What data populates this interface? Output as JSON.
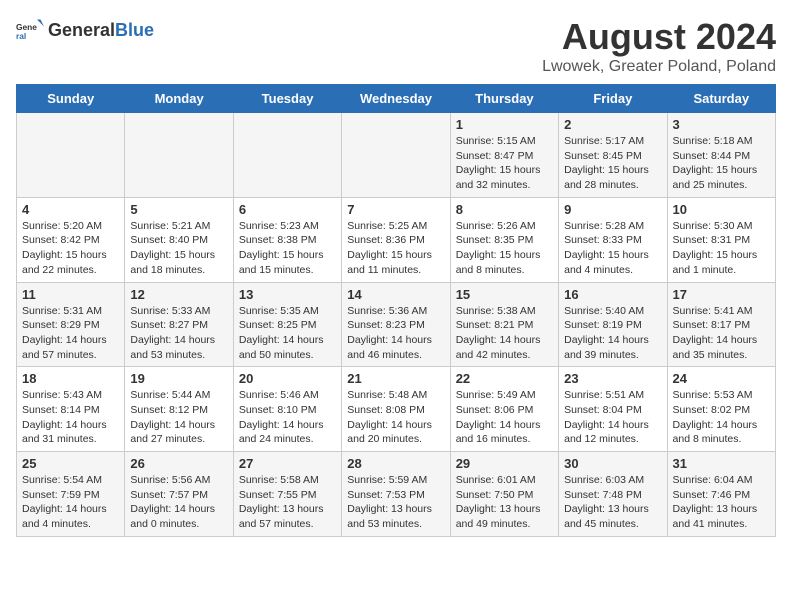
{
  "header": {
    "logo_general": "General",
    "logo_blue": "Blue",
    "title": "August 2024",
    "subtitle": "Lwowek, Greater Poland, Poland"
  },
  "calendar": {
    "days_of_week": [
      "Sunday",
      "Monday",
      "Tuesday",
      "Wednesday",
      "Thursday",
      "Friday",
      "Saturday"
    ],
    "weeks": [
      [
        {
          "day": "",
          "info": ""
        },
        {
          "day": "",
          "info": ""
        },
        {
          "day": "",
          "info": ""
        },
        {
          "day": "",
          "info": ""
        },
        {
          "day": "1",
          "info": "Sunrise: 5:15 AM\nSunset: 8:47 PM\nDaylight: 15 hours\nand 32 minutes."
        },
        {
          "day": "2",
          "info": "Sunrise: 5:17 AM\nSunset: 8:45 PM\nDaylight: 15 hours\nand 28 minutes."
        },
        {
          "day": "3",
          "info": "Sunrise: 5:18 AM\nSunset: 8:44 PM\nDaylight: 15 hours\nand 25 minutes."
        }
      ],
      [
        {
          "day": "4",
          "info": "Sunrise: 5:20 AM\nSunset: 8:42 PM\nDaylight: 15 hours\nand 22 minutes."
        },
        {
          "day": "5",
          "info": "Sunrise: 5:21 AM\nSunset: 8:40 PM\nDaylight: 15 hours\nand 18 minutes."
        },
        {
          "day": "6",
          "info": "Sunrise: 5:23 AM\nSunset: 8:38 PM\nDaylight: 15 hours\nand 15 minutes."
        },
        {
          "day": "7",
          "info": "Sunrise: 5:25 AM\nSunset: 8:36 PM\nDaylight: 15 hours\nand 11 minutes."
        },
        {
          "day": "8",
          "info": "Sunrise: 5:26 AM\nSunset: 8:35 PM\nDaylight: 15 hours\nand 8 minutes."
        },
        {
          "day": "9",
          "info": "Sunrise: 5:28 AM\nSunset: 8:33 PM\nDaylight: 15 hours\nand 4 minutes."
        },
        {
          "day": "10",
          "info": "Sunrise: 5:30 AM\nSunset: 8:31 PM\nDaylight: 15 hours\nand 1 minute."
        }
      ],
      [
        {
          "day": "11",
          "info": "Sunrise: 5:31 AM\nSunset: 8:29 PM\nDaylight: 14 hours\nand 57 minutes."
        },
        {
          "day": "12",
          "info": "Sunrise: 5:33 AM\nSunset: 8:27 PM\nDaylight: 14 hours\nand 53 minutes."
        },
        {
          "day": "13",
          "info": "Sunrise: 5:35 AM\nSunset: 8:25 PM\nDaylight: 14 hours\nand 50 minutes."
        },
        {
          "day": "14",
          "info": "Sunrise: 5:36 AM\nSunset: 8:23 PM\nDaylight: 14 hours\nand 46 minutes."
        },
        {
          "day": "15",
          "info": "Sunrise: 5:38 AM\nSunset: 8:21 PM\nDaylight: 14 hours\nand 42 minutes."
        },
        {
          "day": "16",
          "info": "Sunrise: 5:40 AM\nSunset: 8:19 PM\nDaylight: 14 hours\nand 39 minutes."
        },
        {
          "day": "17",
          "info": "Sunrise: 5:41 AM\nSunset: 8:17 PM\nDaylight: 14 hours\nand 35 minutes."
        }
      ],
      [
        {
          "day": "18",
          "info": "Sunrise: 5:43 AM\nSunset: 8:14 PM\nDaylight: 14 hours\nand 31 minutes."
        },
        {
          "day": "19",
          "info": "Sunrise: 5:44 AM\nSunset: 8:12 PM\nDaylight: 14 hours\nand 27 minutes."
        },
        {
          "day": "20",
          "info": "Sunrise: 5:46 AM\nSunset: 8:10 PM\nDaylight: 14 hours\nand 24 minutes."
        },
        {
          "day": "21",
          "info": "Sunrise: 5:48 AM\nSunset: 8:08 PM\nDaylight: 14 hours\nand 20 minutes."
        },
        {
          "day": "22",
          "info": "Sunrise: 5:49 AM\nSunset: 8:06 PM\nDaylight: 14 hours\nand 16 minutes."
        },
        {
          "day": "23",
          "info": "Sunrise: 5:51 AM\nSunset: 8:04 PM\nDaylight: 14 hours\nand 12 minutes."
        },
        {
          "day": "24",
          "info": "Sunrise: 5:53 AM\nSunset: 8:02 PM\nDaylight: 14 hours\nand 8 minutes."
        }
      ],
      [
        {
          "day": "25",
          "info": "Sunrise: 5:54 AM\nSunset: 7:59 PM\nDaylight: 14 hours\nand 4 minutes."
        },
        {
          "day": "26",
          "info": "Sunrise: 5:56 AM\nSunset: 7:57 PM\nDaylight: 14 hours\nand 0 minutes."
        },
        {
          "day": "27",
          "info": "Sunrise: 5:58 AM\nSunset: 7:55 PM\nDaylight: 13 hours\nand 57 minutes."
        },
        {
          "day": "28",
          "info": "Sunrise: 5:59 AM\nSunset: 7:53 PM\nDaylight: 13 hours\nand 53 minutes."
        },
        {
          "day": "29",
          "info": "Sunrise: 6:01 AM\nSunset: 7:50 PM\nDaylight: 13 hours\nand 49 minutes."
        },
        {
          "day": "30",
          "info": "Sunrise: 6:03 AM\nSunset: 7:48 PM\nDaylight: 13 hours\nand 45 minutes."
        },
        {
          "day": "31",
          "info": "Sunrise: 6:04 AM\nSunset: 7:46 PM\nDaylight: 13 hours\nand 41 minutes."
        }
      ]
    ]
  }
}
